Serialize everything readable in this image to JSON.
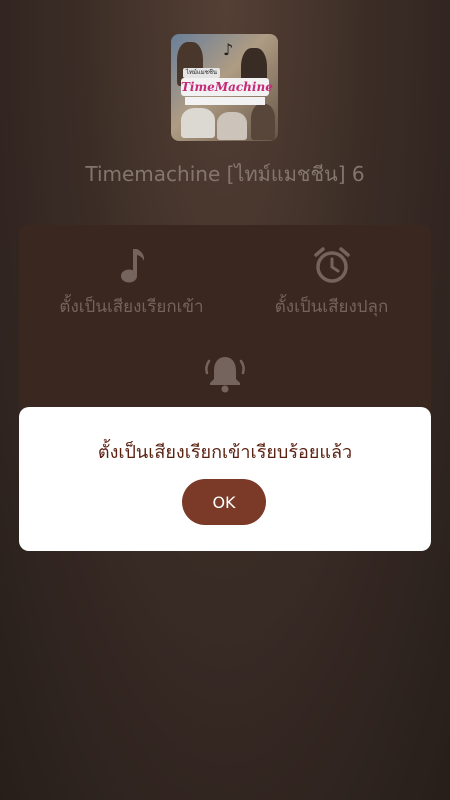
{
  "track": {
    "title": "Timemachine [ไทม์แมชชีน] 6",
    "cover_logo": "TimeMachine",
    "cover_tag": "ไทม์แมชชีน"
  },
  "actions": {
    "ringtone_label": "ตั้งเป็นเสียงเรียกเข้า",
    "alarm_label": "ตั้งเป็นเสียงปลุก"
  },
  "dialog": {
    "message": "ตั้งเป็นเสียงเรียกเข้าเรียบร้อยแล้ว",
    "ok_label": "OK"
  },
  "icons": {
    "ringtone": "music-note-icon",
    "alarm": "alarm-clock-icon",
    "notification": "bell-icon"
  },
  "colors": {
    "accent": "#7a3a27",
    "dialog_text": "#5b2212",
    "muted_text": "#8c7d75"
  }
}
